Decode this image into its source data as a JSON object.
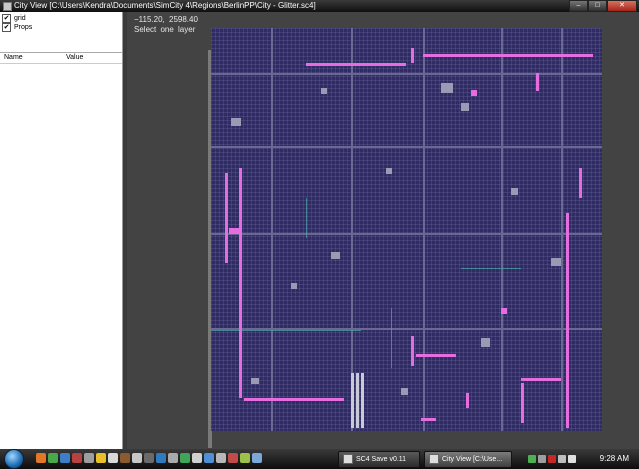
{
  "window": {
    "title": "City View [C:\\Users\\Kendra\\Documents\\SimCity 4\\Regions\\BerlinPP\\City - Glitter.sc4]",
    "min_label": "–",
    "max_label": "□",
    "close_label": "✕"
  },
  "layers": [
    {
      "label": "grid",
      "checked": true,
      "check_mark": "✔"
    },
    {
      "label": "Props",
      "checked": true,
      "check_mark": "✔"
    }
  ],
  "properties": {
    "columns": [
      "Name",
      "Value"
    ]
  },
  "viewport": {
    "coords": "−115.20,  2598.40",
    "hint": "Select  one  layer",
    "map_colors": {
      "background": "#2f2b63",
      "grid": "#8c8cc8",
      "highlight": "#e56de0",
      "roads": "#8a8aa8",
      "water": "#5fb3b3"
    }
  },
  "taskbar": {
    "quick_launch_icons": [
      "firefox-icon",
      "messenger-icon",
      "explorer-icon",
      "game-icon",
      "tool-icon",
      "star-icon",
      "doc-icon",
      "app-icon",
      "app-icon",
      "app-icon",
      "app-icon",
      "app-icon",
      "app-icon",
      "app-icon",
      "app-icon",
      "app-icon",
      "app-icon",
      "app-icon",
      "app-icon"
    ],
    "tasks": [
      {
        "label": "SC4 Save v0.11",
        "active": false
      },
      {
        "label": "City View [C:\\Use...",
        "active": true
      }
    ],
    "clock": "9:28 AM"
  }
}
